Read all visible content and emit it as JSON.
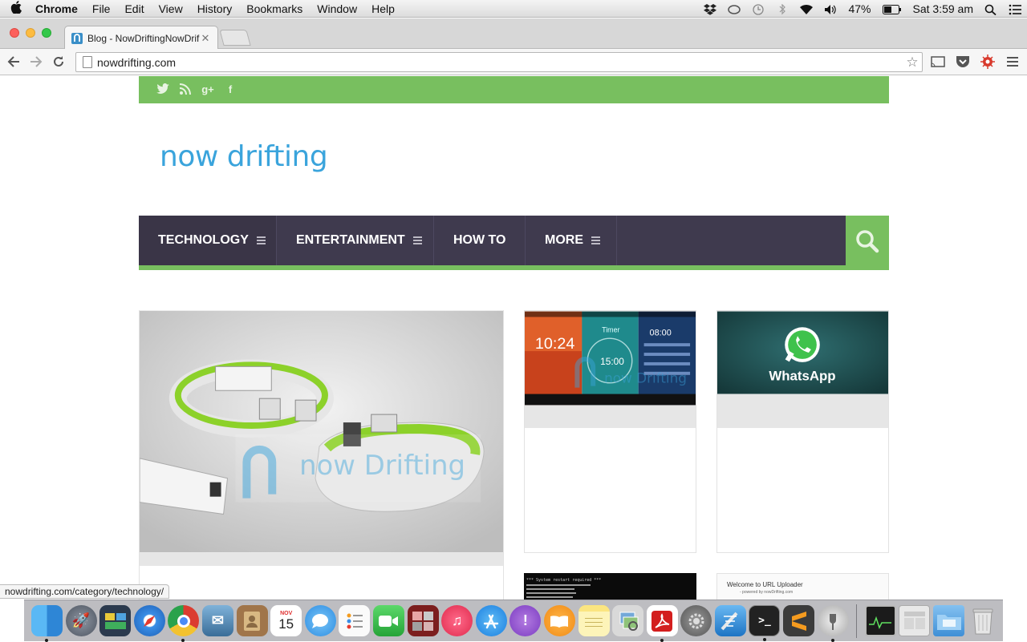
{
  "menubar": {
    "app_name": "Chrome",
    "items": [
      "File",
      "Edit",
      "View",
      "History",
      "Bookmarks",
      "Window",
      "Help"
    ],
    "battery": "47%",
    "clock": "Sat 3:59 am"
  },
  "browser": {
    "tab_title": "Blog - NowDriftingNowDrif",
    "url": "nowdrifting.com",
    "status_url": "nowdrifting.com/category/technology/"
  },
  "site": {
    "logo": "now drifting",
    "nav": [
      {
        "label": "TECHNOLOGY",
        "has_menu": true
      },
      {
        "label": "ENTERTAINMENT",
        "has_menu": true
      },
      {
        "label": "HOW TO",
        "has_menu": false
      },
      {
        "label": "MORE",
        "has_menu": true
      }
    ],
    "social_icons": [
      "twitter-icon",
      "rss-icon",
      "google-plus-icon",
      "facebook-icon"
    ],
    "thumb_texts": {
      "watermark": "now Drifting",
      "android_time_1": "10:24",
      "android_timer_label": "Timer",
      "android_time_2": "15:00",
      "android_time_3": "08:00",
      "whatsapp": "WhatsApp",
      "terminal_line": "*** System restart required ***",
      "uploader_title": "Welcome to URL Uploader",
      "uploader_sub": "- powered by nowDrifting.com"
    }
  },
  "dock": {
    "icons": [
      "finder-icon",
      "launchpad-icon",
      "mission-control-icon",
      "safari-icon",
      "chrome-icon",
      "mail-icon",
      "contacts-icon",
      "calendar-icon",
      "messages-icon",
      "reminders-icon",
      "facetime-icon",
      "photo-booth-icon",
      "itunes-icon",
      "app-store-icon",
      "feedback-icon",
      "ibooks-icon",
      "notes-icon",
      "preview-icon",
      "acrobat-icon",
      "system-preferences-icon",
      "xcode-icon",
      "terminal-icon",
      "sublime-icon",
      "unknown-app-icon",
      "activity-monitor-icon",
      "mamp-icon",
      "folder-icon",
      "trash-icon"
    ],
    "calendar_month": "NOV",
    "calendar_day": "15"
  },
  "colors": {
    "brand_green": "#78bf5f",
    "nav_dark": "#3f3a4e",
    "logo_blue": "#3aa4dc"
  }
}
